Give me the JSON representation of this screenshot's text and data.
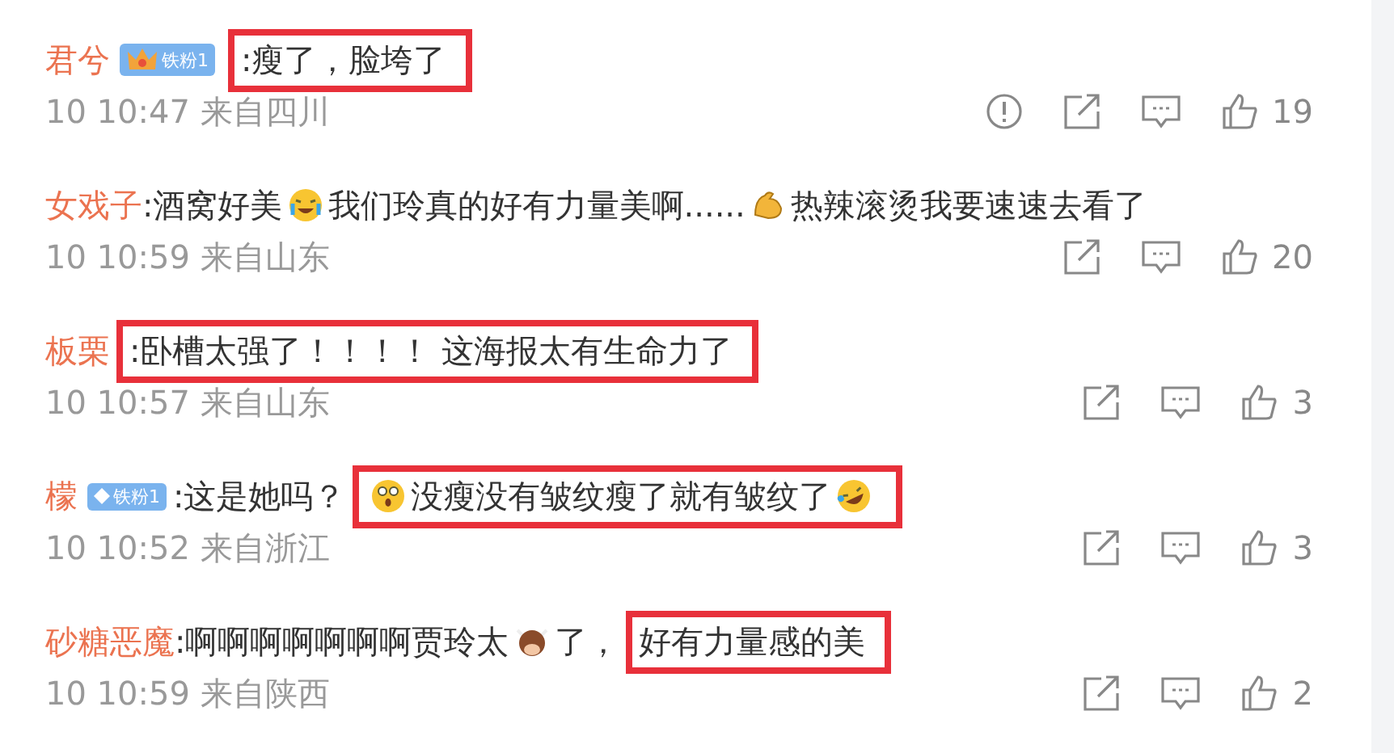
{
  "comments": [
    {
      "author": "君兮",
      "badge": {
        "kind": "crown",
        "label": "铁粉1"
      },
      "parts": [
        {
          "boxed": true,
          "segments": [
            {
              "kind": "text",
              "text": ":瘦了，脸垮了"
            }
          ]
        }
      ],
      "time": "10 10:47",
      "location": "来自四川",
      "actions": [
        {
          "kind": "report"
        },
        {
          "kind": "share"
        },
        {
          "kind": "reply"
        },
        {
          "kind": "like",
          "count": "19"
        }
      ]
    },
    {
      "author": "女戏子",
      "parts": [
        {
          "boxed": false,
          "segments": [
            {
              "kind": "text",
              "text": ":酒窝好美"
            },
            {
              "kind": "crying-emoji"
            },
            {
              "kind": "text",
              "text": "我们玲真的好有力量美啊......"
            },
            {
              "kind": "flex-emoji"
            },
            {
              "kind": "text",
              "text": "热辣滚烫我要速速去看了"
            }
          ]
        }
      ],
      "time": "10 10:59",
      "location": "来自山东",
      "actions": [
        {
          "kind": "share"
        },
        {
          "kind": "reply"
        },
        {
          "kind": "like",
          "count": "20"
        }
      ]
    },
    {
      "author": "板栗",
      "parts": [
        {
          "boxed": true,
          "segments": [
            {
              "kind": "text",
              "text": ":卧槽太强了！！！！ 这海报太有生命力了"
            }
          ]
        }
      ],
      "time": "10 10:57",
      "location": "来自山东",
      "actions": [
        {
          "kind": "share"
        },
        {
          "kind": "reply"
        },
        {
          "kind": "like",
          "count": "3"
        }
      ]
    },
    {
      "author": "檬",
      "badge": {
        "kind": "diamond",
        "label": "铁粉1"
      },
      "parts": [
        {
          "boxed": false,
          "segments": [
            {
              "kind": "text",
              "text": ":这是她吗？"
            }
          ]
        },
        {
          "boxed": true,
          "segments": [
            {
              "kind": "shocked-emoji"
            },
            {
              "kind": "text",
              "text": "没瘦没有皱纹瘦了就有皱纹了"
            },
            {
              "kind": "laugh-emoji"
            }
          ]
        }
      ],
      "time": "10 10:52",
      "location": "来自浙江",
      "actions": [
        {
          "kind": "share"
        },
        {
          "kind": "reply"
        },
        {
          "kind": "like",
          "count": "3"
        }
      ]
    },
    {
      "author": "砂糖恶魔",
      "parts": [
        {
          "boxed": false,
          "segments": [
            {
              "kind": "text",
              "text": ":啊啊啊啊啊啊啊贾玲太"
            },
            {
              "kind": "ox-emoji"
            },
            {
              "kind": "text",
              "text": "了，"
            }
          ]
        },
        {
          "boxed": true,
          "segments": [
            {
              "kind": "text",
              "text": "好有力量感的美"
            }
          ]
        }
      ],
      "time": "10 10:59",
      "location": "来自陕西",
      "actions": [
        {
          "kind": "share"
        },
        {
          "kind": "reply"
        },
        {
          "kind": "like",
          "count": "2"
        }
      ]
    }
  ]
}
